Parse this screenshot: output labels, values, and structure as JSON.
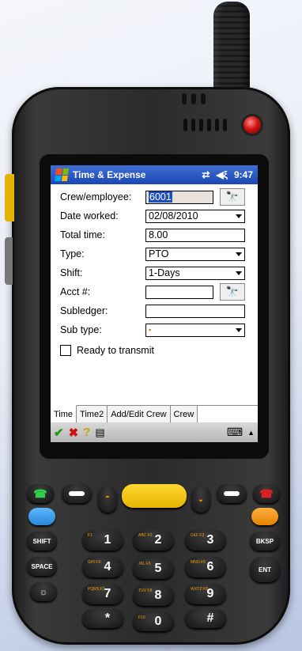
{
  "app": {
    "title": "Time & Expense",
    "status": {
      "connectivity_icon": "sync-arrows-icon",
      "volume_icon": "speaker-icon",
      "time": "9:47"
    }
  },
  "form": {
    "crew_employee": {
      "label": "Crew/employee:",
      "value": "6001"
    },
    "date_worked": {
      "label": "Date worked:",
      "value": "02/08/2010"
    },
    "total_time": {
      "label": "Total time:",
      "value": "8.00"
    },
    "type": {
      "label": "Type:",
      "value": "PTO"
    },
    "shift": {
      "label": "Shift:",
      "value": "1-Days"
    },
    "acct": {
      "label": "Acct #:",
      "value": ""
    },
    "subledger": {
      "label": "Subledger:",
      "value": ""
    },
    "sub_type": {
      "label": "Sub type:",
      "value": ""
    },
    "ready_to_transmit": {
      "label": "Ready to transmit",
      "checked": false
    }
  },
  "tabs": [
    {
      "label": "Time",
      "active": true
    },
    {
      "label": "Time2",
      "active": false
    },
    {
      "label": "Add/Edit Crew",
      "active": false
    },
    {
      "label": "Crew",
      "active": false
    }
  ],
  "command_bar": {
    "ok_icon": "checkmark-icon",
    "cancel_icon": "x-icon",
    "help_icon": "question-icon",
    "copy_icon": "document-icon",
    "keyboard_icon": "keyboard-icon"
  },
  "keypad": {
    "shift": "SHIFT",
    "space": "SPACE",
    "bksp": "BKSP",
    "ent": "ENT",
    "keys": [
      {
        "sub": "F1",
        "num": "1"
      },
      {
        "sub": "ABC F2",
        "num": "2"
      },
      {
        "sub": "DEF F3",
        "num": "3"
      },
      {
        "sub": "GHI F4",
        "num": "4"
      },
      {
        "sub": "JKL F5",
        "num": "5"
      },
      {
        "sub": "MNO F6",
        "num": "6"
      },
      {
        "sub": "PQRS F7",
        "num": "7"
      },
      {
        "sub": "TUV F8",
        "num": "8"
      },
      {
        "sub": "WXYZ F9",
        "num": "9"
      },
      {
        "sub": "",
        "num": "*"
      },
      {
        "sub": "F10",
        "num": "0"
      },
      {
        "sub": "",
        "num": "#"
      }
    ]
  },
  "colors": {
    "titlebar": "#1c47b3",
    "selection": "#1f4fbf",
    "yellow_key": "#f5c400",
    "blue_key": "#3aa0f0",
    "orange_key": "#f59a1a",
    "led": "#d31414"
  }
}
